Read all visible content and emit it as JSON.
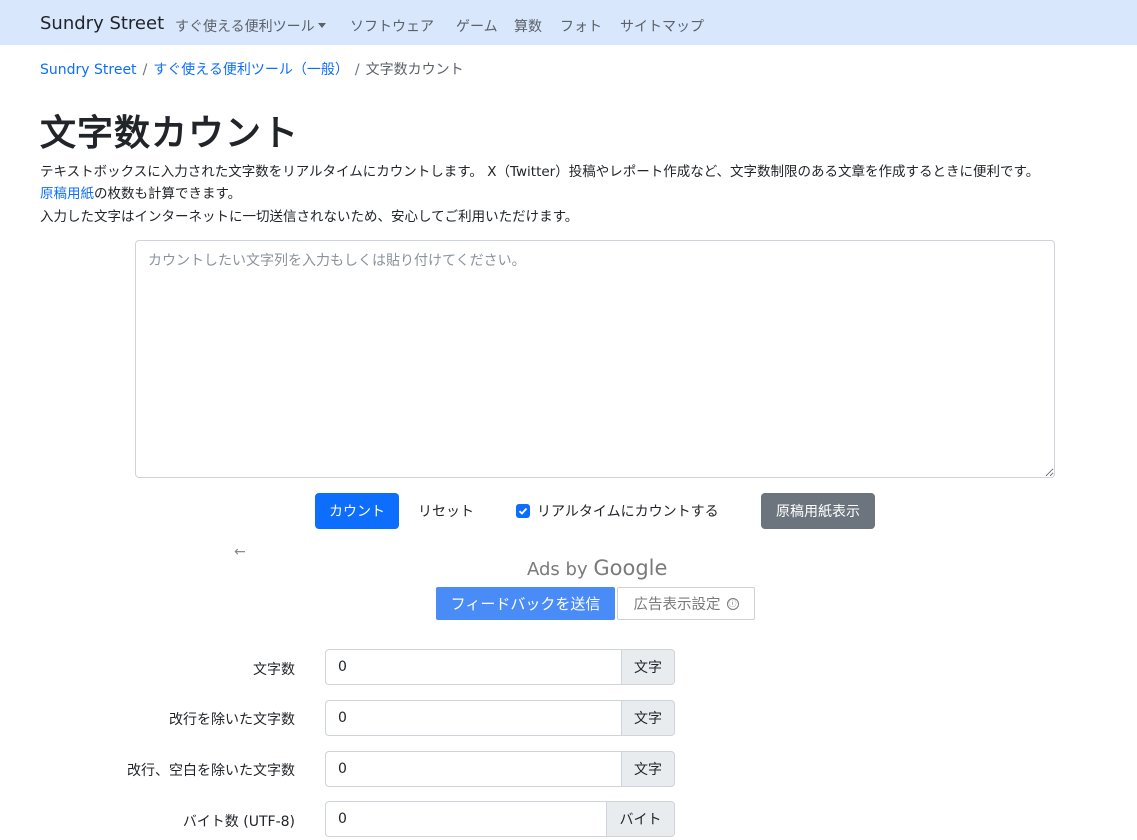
{
  "nav": {
    "brand": "Sundry Street",
    "items": [
      "すぐ使える便利ツール",
      "ソフトウェア",
      "ゲーム",
      "算数",
      "フォト",
      "サイトマップ"
    ]
  },
  "breadcrumb": {
    "items": [
      "Sundry Street",
      "すぐ使える便利ツール（一般）",
      "文字数カウント"
    ],
    "separator": "/"
  },
  "page": {
    "title": "文字数カウント",
    "description_line1": "テキストボックスに入力された文字数をリアルタイムにカウントします。 X（Twitter）投稿やレポート作成など、文字数制限のある文章を作成するときに便利です。",
    "description_link": "原稿用紙",
    "description_line2_rest": "の枚数も計算できます。",
    "description_line3": "入力した文字はインターネットに一切送信されないため、安心してご利用いただけます。"
  },
  "textarea": {
    "placeholder": "カウントしたい文字列を入力もしくは貼り付けてください。",
    "value": ""
  },
  "buttons": {
    "count": "カウント",
    "reset": "リセット",
    "realtime_label": "リアルタイムにカウントする",
    "realtime_checked": true,
    "manuscript": "原稿用紙表示"
  },
  "ad": {
    "back_arrow": "←",
    "ads_by": "Ads by",
    "google": "Google",
    "feedback": "フィードバックを送信",
    "settings": "広告表示設定",
    "info_icon": "ⓘ"
  },
  "results": [
    {
      "label": "文字数",
      "value": "0",
      "unit": "文字"
    },
    {
      "label": "改行を除いた文字数",
      "value": "0",
      "unit": "文字"
    },
    {
      "label": "改行、空白を除いた文字数",
      "value": "0",
      "unit": "文字"
    },
    {
      "label": "バイト数 (UTF-8)",
      "value": "0",
      "unit": "バイト"
    }
  ],
  "colors": {
    "navbar_bg": "#d9e7fd",
    "primary": "#0d6efd",
    "secondary": "#6c757d",
    "feedback_blue": "#4a8cf7"
  }
}
